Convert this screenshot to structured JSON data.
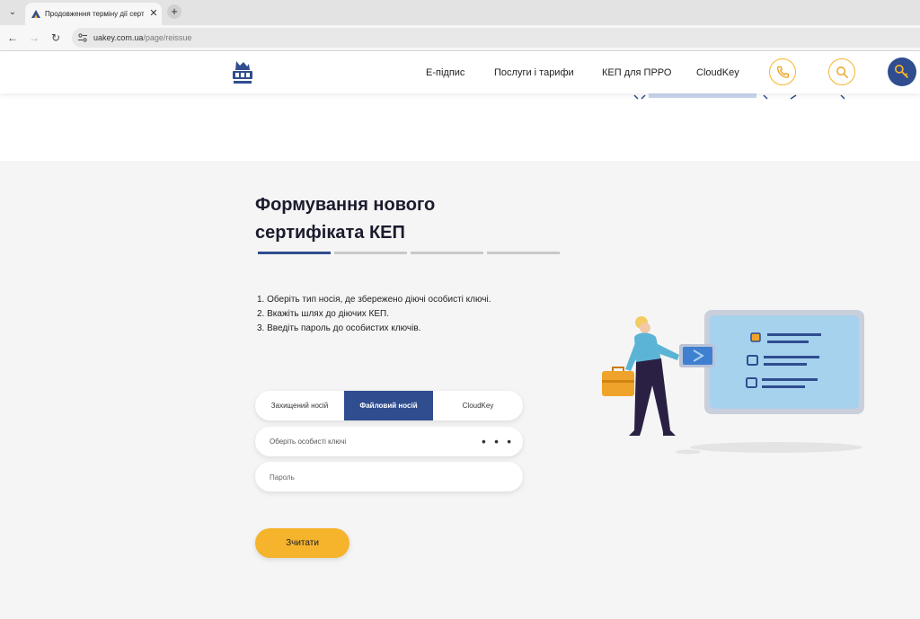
{
  "browser": {
    "tab_title": "Продовження терміну дії серт",
    "url_host": "uakey.com.ua",
    "url_path": "/page/reissue",
    "close_glyph": "✕",
    "new_tab_glyph": "+",
    "back_glyph": "←",
    "forward_glyph": "→",
    "reload_glyph": "↻",
    "menu_glyph": "⌄"
  },
  "header": {
    "logo_icon": "usk-ukraine-logo-icon",
    "nav": [
      {
        "label": "Е-підпис"
      },
      {
        "label": "Послуги і тарифи"
      },
      {
        "label": "КЕП для ПРРО"
      },
      {
        "label": "CloudKey"
      }
    ],
    "icons": [
      "phone-icon",
      "search-icon",
      "key-icon"
    ]
  },
  "main": {
    "title_line1": "Формування нового",
    "title_line2": "сертифіката КЕП",
    "steps_total": 4,
    "steps_current": 1,
    "instructions": [
      "1. Оберіть тип носія, де збережено діючі особисті ключі.",
      "2. Вкажіть шлях до діючих КЕП.",
      "3. Введіть пароль до особистих ключів."
    ],
    "media_options": [
      {
        "label": "Захищений носій",
        "active": false
      },
      {
        "label": "Файловий носій",
        "active": true
      },
      {
        "label": "CloudKey",
        "active": false
      }
    ],
    "key_field_label": "Оберіть особисті ключі",
    "key_field_dots": "• • •",
    "password_placeholder": "Пароль",
    "read_button": "Зчитати"
  },
  "colors": {
    "brand_blue": "#2f4d8f",
    "accent_yellow": "#f5b42c",
    "section_bg": "#f5f5f5"
  }
}
